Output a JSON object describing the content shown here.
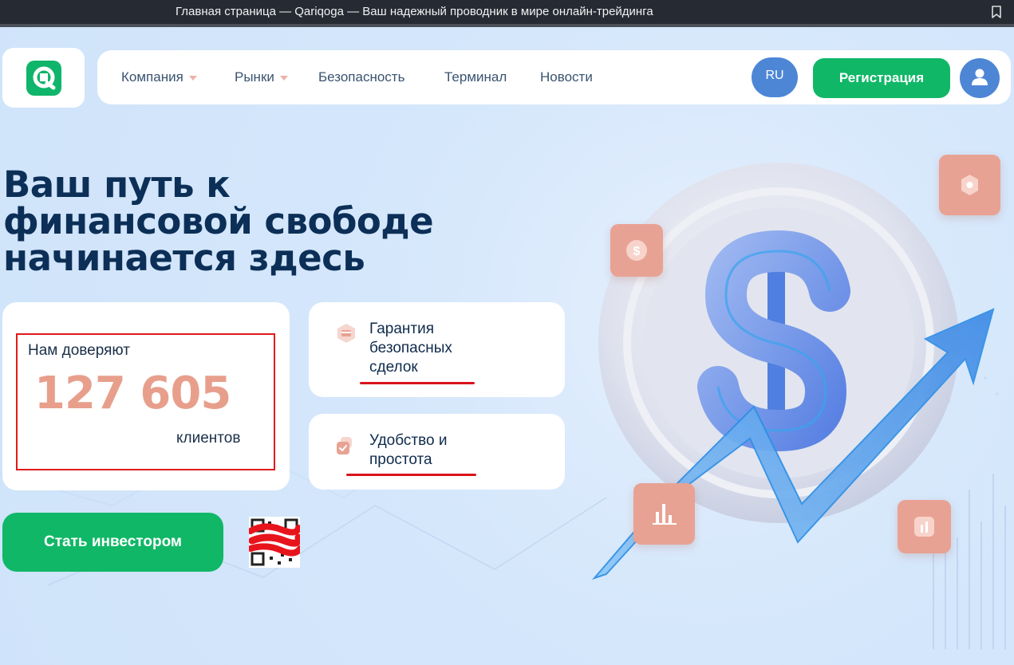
{
  "browser": {
    "title": "Главная страница — Qariqoga — Ваш надежный проводник в мире онлайн-трейдинга"
  },
  "header": {
    "nav": [
      {
        "label": "Компания",
        "has_dropdown": true
      },
      {
        "label": "Рынки",
        "has_dropdown": true
      },
      {
        "label": "Безопасность",
        "has_dropdown": false
      },
      {
        "label": "Терминал",
        "has_dropdown": false
      },
      {
        "label": "Новости",
        "has_dropdown": false
      }
    ],
    "language": "RU",
    "register_label": "Регистрация"
  },
  "hero": {
    "title_lines": [
      "Ваш путь к",
      "финансовой свободе",
      "начинается здесь"
    ],
    "trust": {
      "label": "Нам доверяют",
      "count": "127 605",
      "suffix": "клиентов"
    },
    "features": [
      {
        "lines": [
          "Гарантия",
          "безопасных",
          "сделок"
        ],
        "icon": "card-icon"
      },
      {
        "lines": [
          "Удобство и",
          "простота"
        ],
        "icon": "check-icon"
      }
    ],
    "cta_label": "Стать инвестором"
  },
  "colors": {
    "accent_green": "#10b767",
    "accent_blue": "#4e86d6",
    "number_salmon": "#e79f8c",
    "title_navy": "#0c2f57"
  }
}
